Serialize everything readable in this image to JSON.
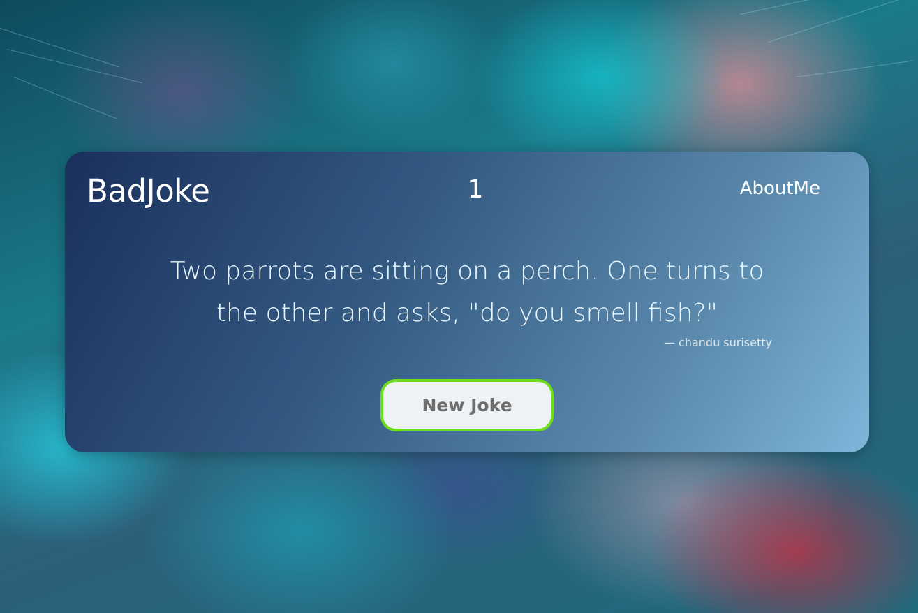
{
  "header": {
    "brand": "BadJoke",
    "joke_count": "1",
    "about_link": "AboutMe"
  },
  "joke": {
    "text": "Two parrots are sitting on a perch. One turns to the other and asks, \"do you smell fish?\"",
    "attribution": "— chandu surisetty"
  },
  "actions": {
    "new_joke_label": "New Joke"
  },
  "colors": {
    "button_border": "#6fdc1c",
    "button_background": "#eef2f4",
    "button_text": "#6d6d6d",
    "card_gradient_start": "#1a2f5c",
    "card_gradient_end": "#7fb6d9"
  }
}
